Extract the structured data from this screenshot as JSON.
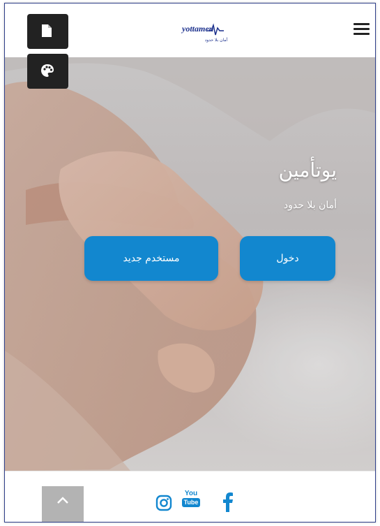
{
  "header": {
    "logo_text": "yottamen",
    "logo_tagline": "أمان بلا حدود"
  },
  "floating": {
    "page_icon": "page-icon",
    "palette_icon": "palette-icon"
  },
  "hero": {
    "title": "يوتأمين",
    "subtitle": "أمان بلا حدود",
    "login_label": "دخول",
    "new_user_label": "مستخدم جديد"
  },
  "footer": {
    "social": [
      "instagram-icon",
      "youtube-icon",
      "facebook-icon"
    ],
    "youtube_top": "You",
    "youtube_bottom": "Tube"
  },
  "colors": {
    "accent": "#1287cf",
    "dark": "#222222",
    "border": "#2f3f8a"
  }
}
